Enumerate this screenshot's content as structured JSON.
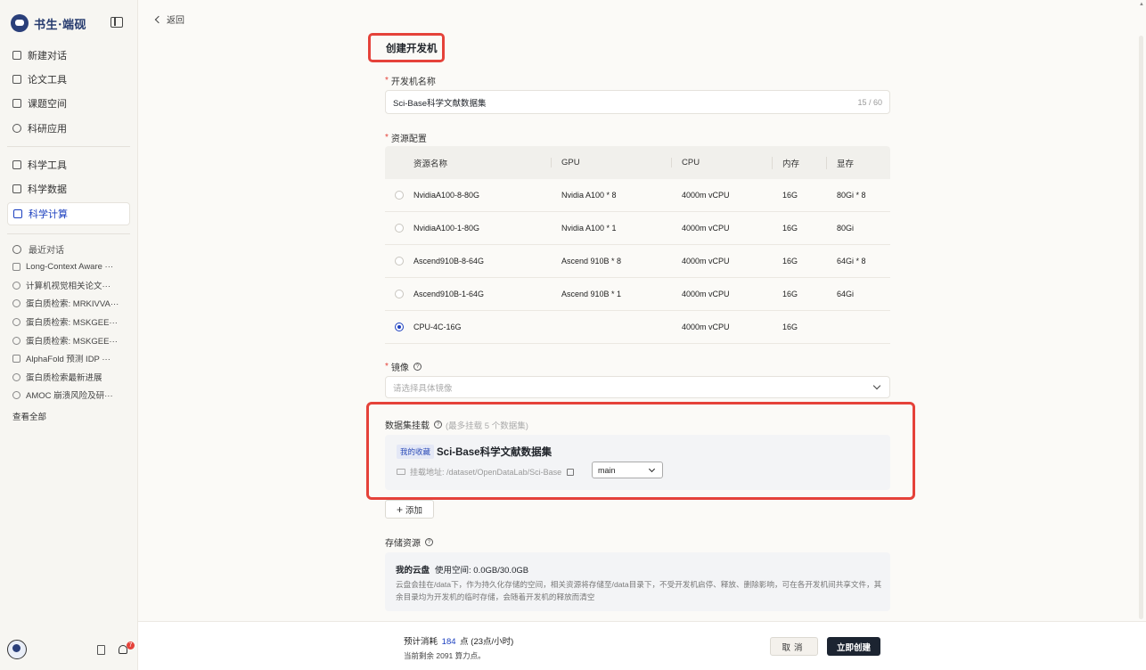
{
  "app": {
    "logo_text": "书生·端砚"
  },
  "sidebar": {
    "nav_top": [
      {
        "label": "新建对话",
        "icon": "plus-square-icon"
      },
      {
        "label": "论文工具",
        "icon": "document-icon"
      },
      {
        "label": "课题空间",
        "icon": "building-icon"
      },
      {
        "label": "科研应用",
        "icon": "cube-icon"
      }
    ],
    "nav_mid": [
      {
        "label": "科学工具",
        "icon": "toolbox-icon"
      },
      {
        "label": "科学数据",
        "icon": "database-icon"
      },
      {
        "label": "科学计算",
        "icon": "monitor-icon",
        "active": true
      }
    ],
    "recent_title": "最近对话",
    "recent": [
      "Long-Context Aware ···",
      "计算机视觉相关论文···",
      "蛋白质检索: MRKIVVA···",
      "蛋白质检索: MSKGEE···",
      "蛋白质检索: MSKGEE···",
      "AlphaFold 预测 IDP ···",
      "蛋白质检索最新进展",
      "AMOC 崩溃风险及研···"
    ],
    "view_all": "查看全部",
    "notification_count": "7"
  },
  "header": {
    "back_label": "返回",
    "title": "创建开发机"
  },
  "form": {
    "name_label": "开发机名称",
    "name_value": "Sci-Base科学文献数据集",
    "name_count": "15 / 60",
    "resource_label": "资源配置",
    "resource_columns": [
      "资源名称",
      "GPU",
      "CPU",
      "内存",
      "显存"
    ],
    "resources": [
      {
        "name": "NvidiaA100-8-80G",
        "gpu": "Nvidia A100 * 8",
        "cpu": "4000m vCPU",
        "mem": "16G",
        "vram": "80Gi * 8",
        "selected": false
      },
      {
        "name": "NvidiaA100-1-80G",
        "gpu": "Nvidia A100 * 1",
        "cpu": "4000m vCPU",
        "mem": "16G",
        "vram": "80Gi",
        "selected": false
      },
      {
        "name": "Ascend910B-8-64G",
        "gpu": "Ascend 910B * 8",
        "cpu": "4000m vCPU",
        "mem": "16G",
        "vram": "64Gi * 8",
        "selected": false
      },
      {
        "name": "Ascend910B-1-64G",
        "gpu": "Ascend 910B * 1",
        "cpu": "4000m vCPU",
        "mem": "16G",
        "vram": "64Gi",
        "selected": false
      },
      {
        "name": "CPU-4C-16G",
        "gpu": "",
        "cpu": "4000m vCPU",
        "mem": "16G",
        "vram": "",
        "selected": true
      }
    ],
    "image_label": "镜像",
    "image_placeholder": "请选择具体镜像",
    "dataset_label": "数据集挂载",
    "dataset_hint": "(最多挂载 5 个数据集)",
    "dataset": {
      "tag": "我的收藏",
      "name": "Sci-Base科学文献数据集",
      "mount_path": "挂载地址: /dataset/OpenDataLab/Sci-Base",
      "branch": "main"
    },
    "add_label": "添加",
    "storage_label": "存储资源",
    "storage": {
      "title": "我的云盘",
      "usage": "使用空间: 0.0GB/30.0GB",
      "desc": "云盘会挂在/data下，作为持久化存储的空间，相关资源将存储至/data目录下，不受开发机启停、释放、删除影响，可在各开发机间共享文件，其余目录均为开发机的临时存储，会随着开发机的释放而清空"
    }
  },
  "footer": {
    "cost_prefix": "预计消耗",
    "cost_value": "184",
    "cost_suffix": "点 (23点/小时)",
    "remain": "当前剩余 2091 算力点。",
    "cancel_label": "取消",
    "create_label": "立即创建"
  },
  "colors": {
    "accent": "#1b3fbf",
    "highlight": "#e5423a",
    "primary_button": "#1c2431"
  }
}
